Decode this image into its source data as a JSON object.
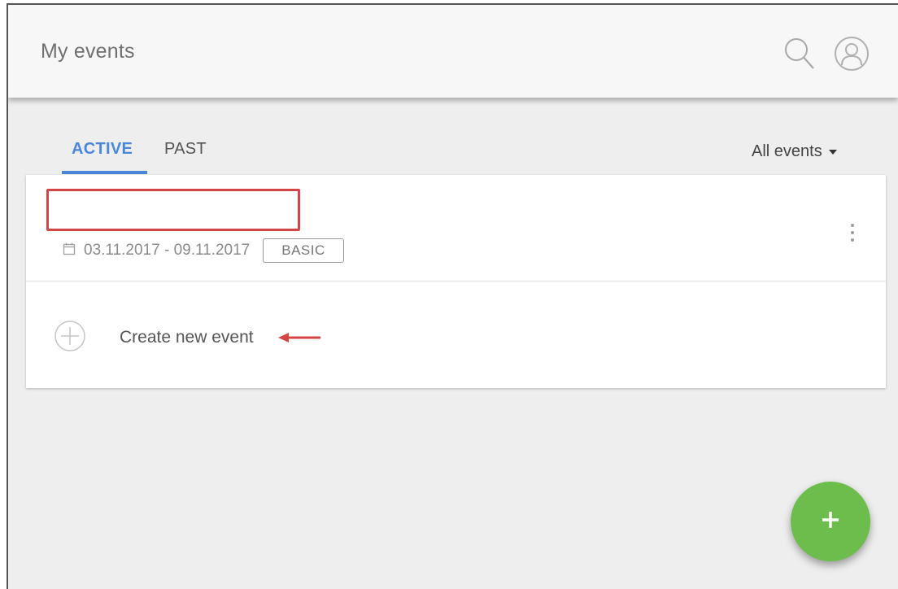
{
  "appbar": {
    "title": "My events",
    "icons": [
      "search-icon",
      "account-icon"
    ]
  },
  "tabs": [
    {
      "label": "ACTIVE",
      "active": true
    },
    {
      "label": "PAST",
      "active": false
    }
  ],
  "filter": {
    "label": "All events",
    "icon": "caret-down-icon"
  },
  "events": [
    {
      "title": "",
      "title_redacted": true,
      "dates": "03.11.2017 - 09.11.2017",
      "badge": "BASIC",
      "icon": "calendar-icon"
    }
  ],
  "create": {
    "label": "Create new event",
    "icon": "plus-circle-icon"
  },
  "fab": {
    "label": "+",
    "icon": "plus-icon"
  },
  "colors": {
    "accent": "#4a86d9",
    "fab": "#6cbd4c",
    "annotation": "#d64545",
    "appbar": "#f7f7f7",
    "background": "#eeeeee"
  }
}
